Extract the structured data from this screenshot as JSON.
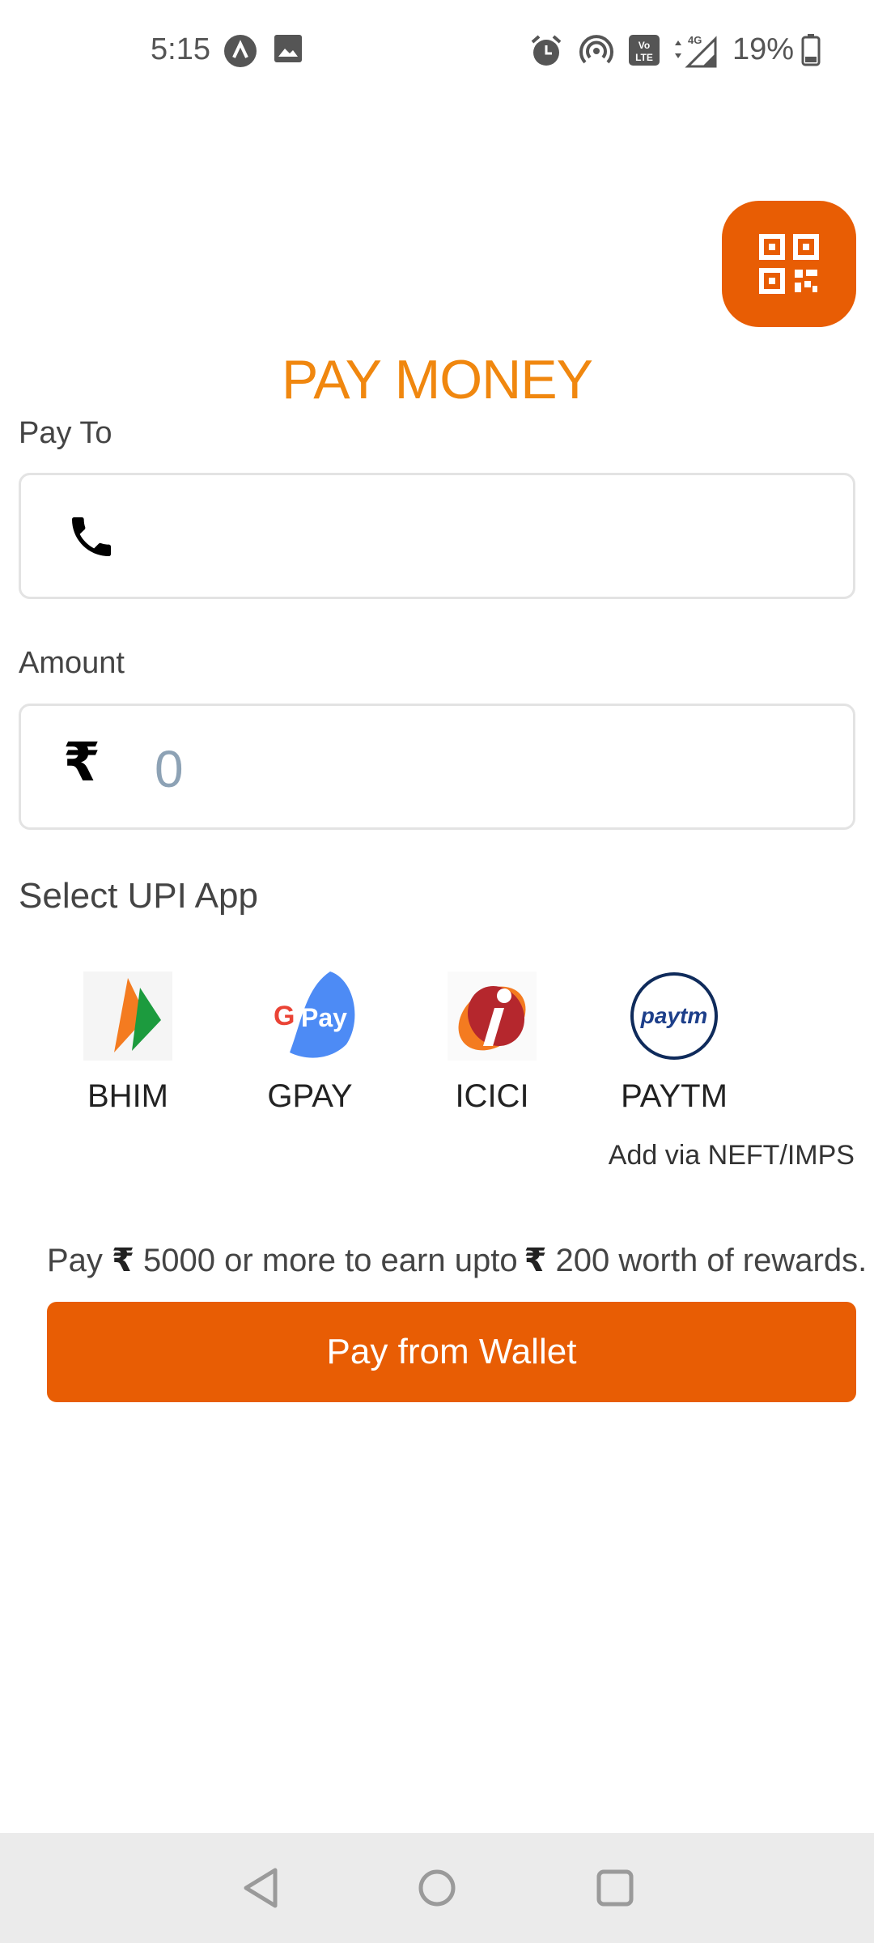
{
  "status_bar": {
    "time": "5:15",
    "battery": "19%",
    "icons": [
      "app-notification-icon",
      "image-icon",
      "alarm-icon",
      "hotspot-icon",
      "volte-icon",
      "signal-4g-icon",
      "battery-icon"
    ]
  },
  "header": {
    "title": "PAY MONEY",
    "qr_icon": "qr-code-icon"
  },
  "pay_to": {
    "label": "Pay To",
    "icon": "phone-icon",
    "value": ""
  },
  "amount": {
    "label": "Amount",
    "currency_symbol": "₹",
    "placeholder": "0"
  },
  "upi": {
    "title": "Select UPI App",
    "apps": [
      {
        "label": "BHIM",
        "icon": "bhim-logo-icon"
      },
      {
        "label": "GPAY",
        "icon": "gpay-logo-icon",
        "logo_text": "Pay",
        "logo_letter": "G"
      },
      {
        "label": "ICICI",
        "icon": "icici-logo-icon"
      },
      {
        "label": "PAYTM",
        "icon": "paytm-logo-icon",
        "logo_text": "paytm"
      }
    ],
    "neft_link": "Add via NEFT/IMPS"
  },
  "rewards": {
    "prefix": "Pay",
    "currency": "₹",
    "min_amount": "5000",
    "middle": "or more to earn upto",
    "reward_amount": "200",
    "suffix": "worth of rewards."
  },
  "wallet_button": {
    "label": "Pay from Wallet"
  },
  "colors": {
    "accent": "#e85d04",
    "title": "#f0870f",
    "placeholder": "#8da2b5"
  },
  "nav": {
    "icons": [
      "back-icon",
      "home-icon",
      "recents-icon"
    ]
  }
}
